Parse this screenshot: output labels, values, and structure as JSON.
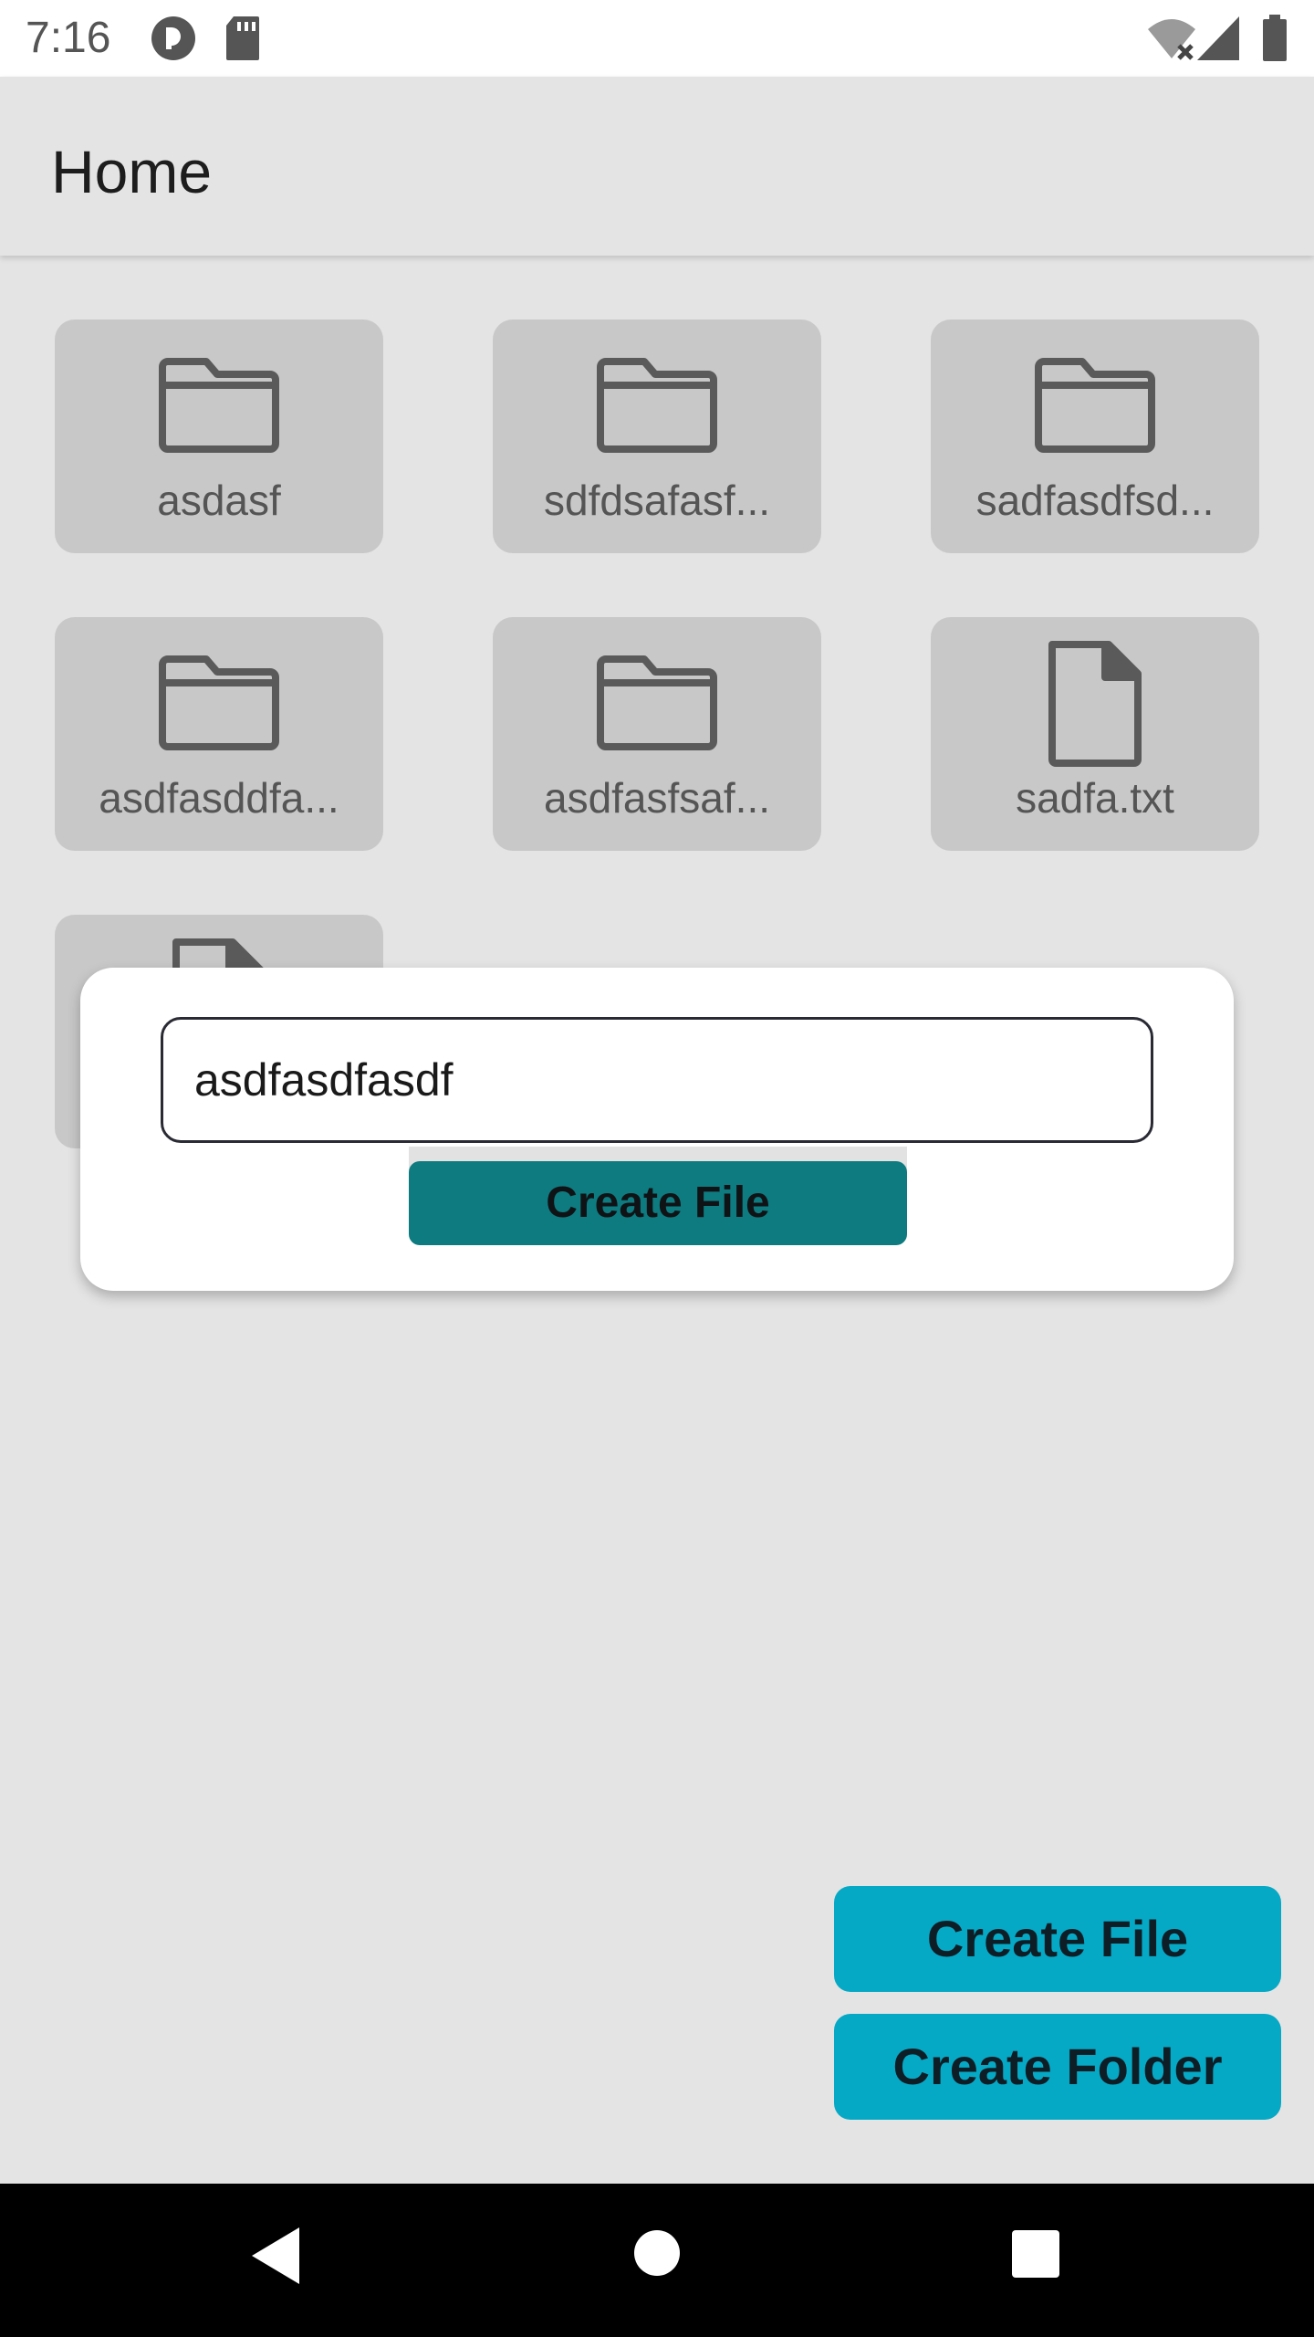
{
  "status_bar": {
    "time": "7:16",
    "icons": [
      "app-notification-icon",
      "sd-card-icon",
      "wifi-off-icon",
      "cell-signal-icon",
      "battery-icon"
    ]
  },
  "app_bar": {
    "title": "Home"
  },
  "items": [
    {
      "name": "asdasf",
      "type": "folder"
    },
    {
      "name": "sdfdsafasf...",
      "type": "folder"
    },
    {
      "name": "sadfasdfsd...",
      "type": "folder"
    },
    {
      "name": "asdfasddfa...",
      "type": "folder"
    },
    {
      "name": "asdfasfsaf...",
      "type": "folder"
    },
    {
      "name": "sadfa.txt",
      "type": "file"
    },
    {
      "name": "",
      "type": "file"
    }
  ],
  "dialog": {
    "input_value": "asdfasdfasdf",
    "submit_label": "Create File"
  },
  "actions": {
    "create_file_label": "Create File",
    "create_folder_label": "Create Folder"
  },
  "colors": {
    "dialog_button": "#0d7b80",
    "action_button": "#06a9c5",
    "tile": "#c8c8c8",
    "background": "#e4e4e4"
  },
  "nav": {
    "buttons": [
      "back-icon",
      "home-icon",
      "recents-icon"
    ]
  }
}
